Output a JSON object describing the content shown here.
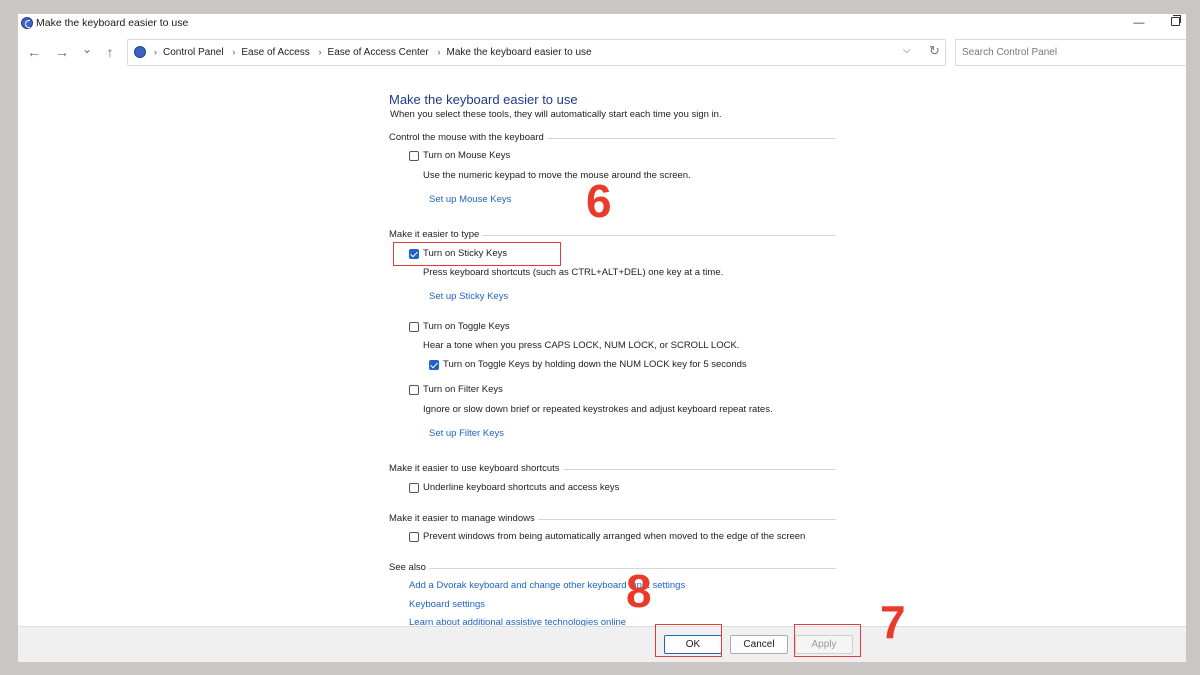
{
  "window": {
    "title": "Make the keyboard easier to use"
  },
  "nav": {
    "back_glyph": "←",
    "forward_glyph": "→",
    "recent_glyph": "⌄",
    "up_glyph": "↑",
    "breadcrumbs": [
      "Control Panel",
      "Ease of Access",
      "Ease of Access Center",
      "Make the keyboard easier to use"
    ],
    "search_placeholder": "Search Control Panel"
  },
  "page": {
    "title": "Make the keyboard easier to use",
    "subtitle": "When you select these tools, they will automatically start each time you sign in."
  },
  "sections": {
    "mouse": {
      "label": "Control the mouse with the keyboard",
      "mouse_keys": {
        "label": "Turn on Mouse Keys",
        "checked": false
      },
      "mouse_keys_desc": "Use the numeric keypad to move the mouse around the screen.",
      "mouse_keys_link": "Set up Mouse Keys"
    },
    "type": {
      "label": "Make it easier to type",
      "sticky_keys": {
        "label": "Turn on Sticky Keys",
        "checked": true
      },
      "sticky_keys_desc": "Press keyboard shortcuts (such as CTRL+ALT+DEL) one key at a time.",
      "sticky_keys_link": "Set up Sticky Keys",
      "toggle_keys": {
        "label": "Turn on Toggle Keys",
        "checked": false
      },
      "toggle_keys_desc": "Hear a tone when you press CAPS LOCK, NUM LOCK, or SCROLL LOCK.",
      "toggle_keys_hold": {
        "label": "Turn on Toggle Keys by holding down the NUM LOCK key for 5 seconds",
        "checked": true
      },
      "filter_keys": {
        "label": "Turn on Filter Keys",
        "checked": false
      },
      "filter_keys_desc": "Ignore or slow down brief or repeated keystrokes and adjust keyboard repeat rates.",
      "filter_keys_link": "Set up Filter Keys"
    },
    "shortcuts": {
      "label": "Make it easier to use keyboard shortcuts",
      "underline": {
        "label": "Underline keyboard shortcuts and access keys",
        "checked": false
      }
    },
    "windows": {
      "label": "Make it easier to manage windows",
      "prevent_arrange": {
        "label": "Prevent windows from being automatically arranged when moved to the edge of the screen",
        "checked": false
      }
    },
    "see_also": {
      "label": "See also",
      "links": [
        "Add a Dvorak keyboard and change other keyboard input settings",
        "Keyboard settings",
        "Learn about additional assistive technologies online"
      ]
    }
  },
  "buttons": {
    "ok": "OK",
    "cancel": "Cancel",
    "apply": "Apply"
  },
  "annotations": {
    "step_sticky": "6",
    "step_apply": "7",
    "step_ok": "8"
  },
  "colors": {
    "annotation": "#ea3a2c",
    "link": "#1f63c7",
    "title": "#1e3c8c"
  }
}
